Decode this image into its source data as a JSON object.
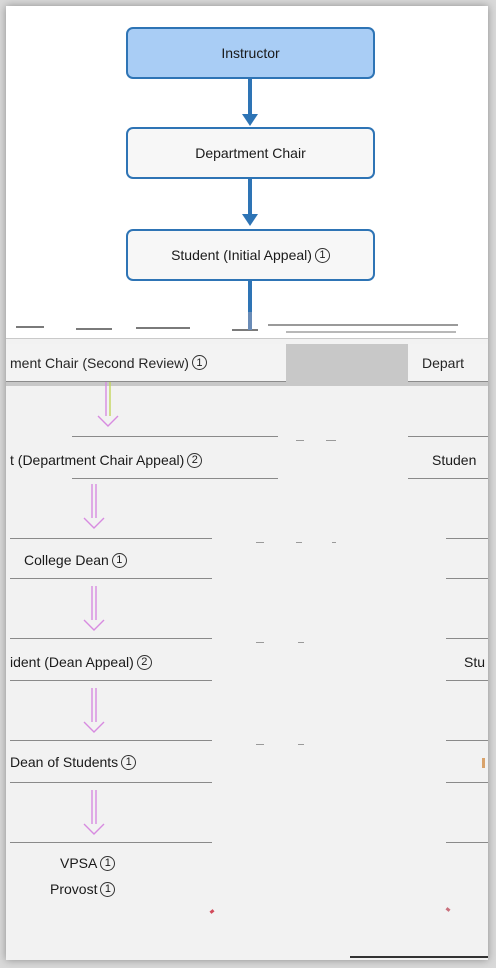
{
  "flow": {
    "instructor": "Instructor",
    "department_chair": "Department Chair",
    "student_initial": "Student (Initial Appeal)",
    "student_initial_badge": "1"
  },
  "steps": {
    "chair_second": "ment Chair (Second Review)",
    "chair_second_badge": "1",
    "depart_right": "Depart",
    "student_chair_appeal": "t (Department Chair Appeal)",
    "student_chair_appeal_badge": "2",
    "student_right": "Studen",
    "college_dean": "College Dean",
    "college_dean_badge": "1",
    "student_dean": "ident (Dean Appeal)",
    "student_dean_badge": "2",
    "stu_right": "Stu",
    "dean_students": "Dean of Students",
    "dean_students_badge": "1",
    "vpsa": "VPSA",
    "vpsa_badge": "1",
    "provost": "Provost",
    "provost_badge": "1"
  },
  "colors": {
    "flow_border": "#2e74b5",
    "highlight_fill": "#a9cdf5",
    "pink_arrow": "#d78be0",
    "lime_arrow": "#c3d65a"
  }
}
